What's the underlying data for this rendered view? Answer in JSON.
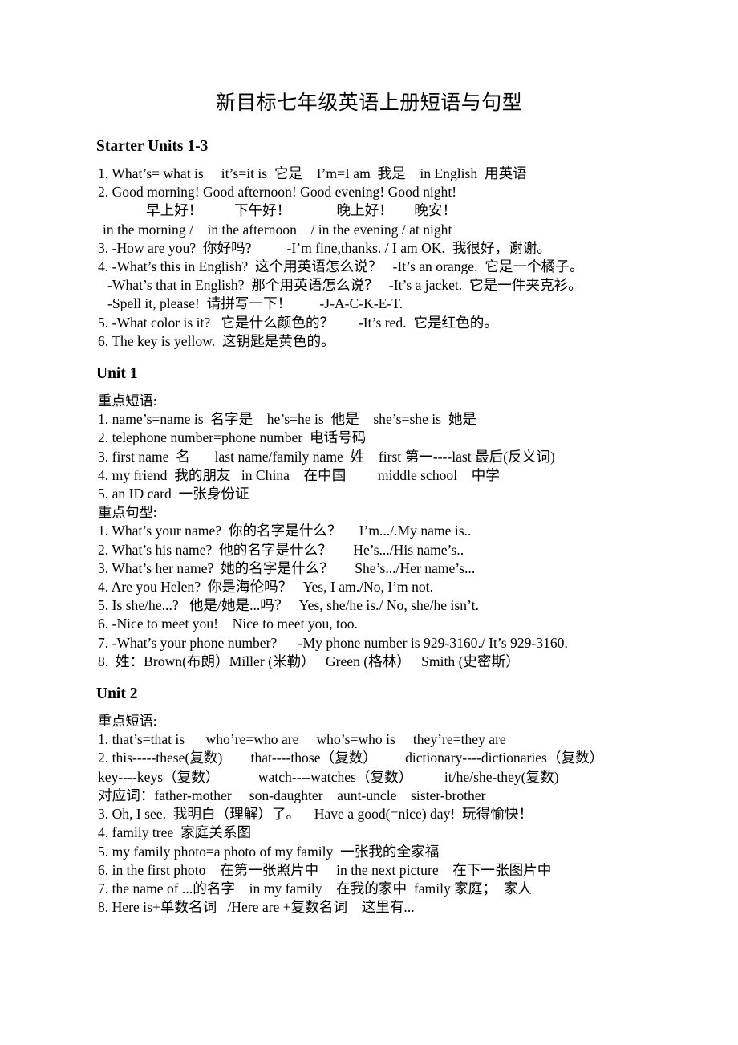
{
  "document": {
    "title": "新目标七年级英语上册短语与句型"
  },
  "sections": [
    {
      "heading": "Starter Units 1-3",
      "lines": [
        "1. What’s= what is     it’s=it is  它是    I’m=I am  我是    in English  用英语",
        "2. Good morning! Good afternoon! Good evening! Good night!",
        "早上好！         下午好！             晚上好！      晚安！",
        "in the morning /    in the afternoon    / in the evening / at night",
        "3. -How are you?  你好吗?          -I’m fine,thanks. / I am OK.  我很好，谢谢。",
        "4. -What’s this in English?  这个用英语怎么说？   -It’s an orange.  它是一个橘子。",
        "-What’s that in English?  那个用英语怎么说？   -It’s a jacket.  它是一件夹克衫。",
        "-Spell it, please!  请拼写一下！        -J-A-C-K-E-T.",
        "5. -What color is it?   它是什么颜色的？       -It’s red.  它是红色的。",
        "6. The key is yellow.  这钥匙是黄色的。"
      ]
    },
    {
      "heading": "Unit 1",
      "lines": [
        "重点短语:",
        "1. name’s=name is  名字是    he’s=he is  他是    she’s=she is  她是",
        "2. telephone number=phone number  电话号码",
        "3. first name  名       last name/family name  姓    first 第一----last 最后(反义词)",
        "4. my friend  我的朋友   in China    在中国         middle school    中学",
        "5. an ID card  一张身份证",
        "重点句型:",
        "1. What’s your name?  你的名字是什么？     I’m.../.My name is..",
        "2. What’s his name?  他的名字是什么？      He’s.../His name’s..",
        "3. What’s her name?  她的名字是什么？      She’s.../Her name’s...",
        "4. Are you Helen?  你是海伦吗？   Yes, I am./No, I’m not.",
        "5. Is she/he...?   他是/她是...吗？   Yes, she/he is./ No, she/he isn’t.",
        "6. -Nice to meet you!    Nice to meet you, too.",
        "7. -What’s your phone number?      -My phone number is 929-3160./ It’s 929-3160.",
        "8.  姓：Brown(布朗）Miller (米勒）   Green (格林）   Smith (史密斯）"
      ]
    },
    {
      "heading": "Unit 2",
      "lines": [
        "重点短语:",
        "1. that’s=that is      who’re=who are     who’s=who is     they’re=they are",
        "2. this-----these(复数)        that----those（复数）        dictionary----dictionaries（复数）",
        "key----keys（复数）           watch----watches（复数）         it/he/she-they(复数)",
        "对应词：father-mother     son-daughter    aunt-uncle    sister-brother",
        "3. Oh, I see.  我明白（理解）了。    Have a good(=nice) day!  玩得愉快！",
        "4. family tree  家庭关系图",
        "5. my family photo=a photo of my family  一张我的全家福",
        "6. in the first photo    在第一张照片中     in the next picture    在下一张图片中",
        "7. the name of ...的名字    in my family    在我的家中  family 家庭；  家人",
        "8. Here is+单数名词   /Here are +复数名词    这里有..."
      ]
    }
  ]
}
